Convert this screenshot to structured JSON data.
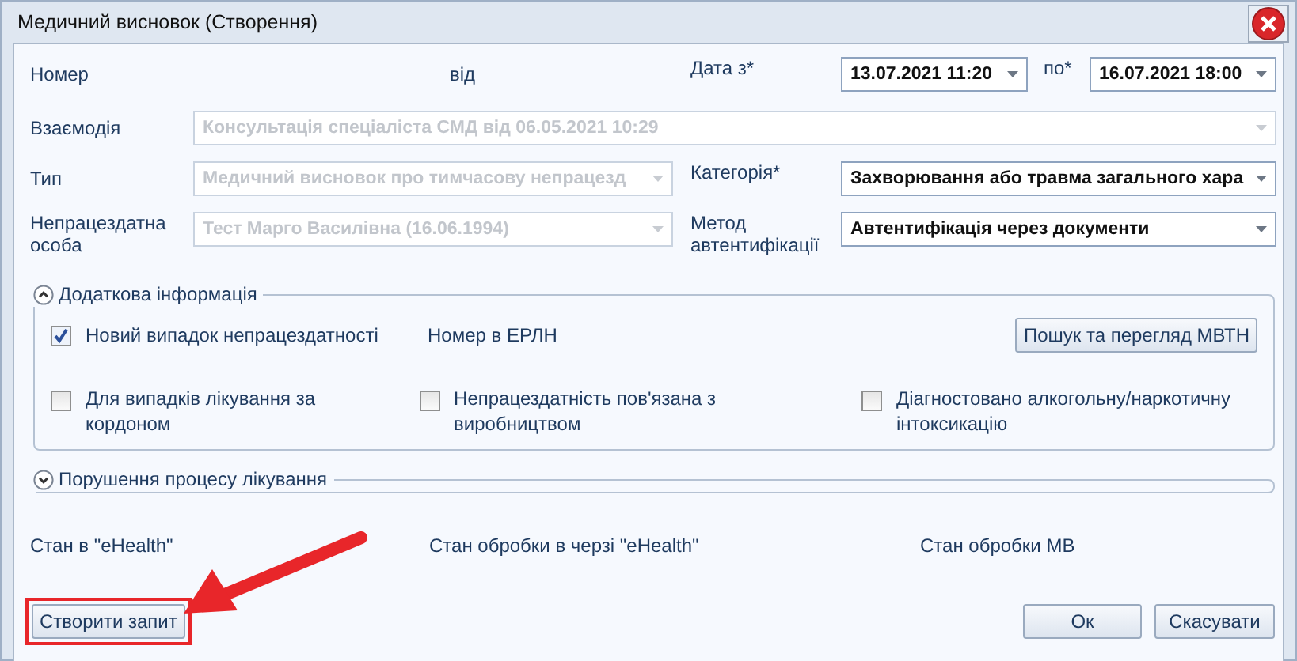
{
  "window": {
    "title": "Медичний висновок (Створення)"
  },
  "number": {
    "label": "Номер"
  },
  "from_label": "від",
  "date_from": {
    "label": "Дата з*",
    "value": "13.07.2021 11:20"
  },
  "date_to": {
    "label": "по*",
    "value": "16.07.2021 18:00"
  },
  "interaction": {
    "label": "Взаємодія",
    "value": "Консультація спеціаліста СМД від 06.05.2021 10:29",
    "disabled": true
  },
  "type": {
    "label": "Тип",
    "value": "Медичний висновок про тимчасову непрацезд",
    "disabled": true
  },
  "category": {
    "label": "Категорія*",
    "value": "Захворювання або травма загального хара",
    "disabled": false
  },
  "person": {
    "label": "Непрацездатна особа",
    "value": "Тест Марго Василівна (16.06.1994)",
    "disabled": true
  },
  "auth_method": {
    "label": "Метод автентифікації",
    "value": "Автентифікація через документи",
    "disabled": false
  },
  "additional_info": {
    "title": "Додаткова інформація",
    "expanded": true,
    "new_case": {
      "label": "Новий випадок непрацездатності",
      "checked": true
    },
    "erln_label": "Номер в ЕРЛН",
    "search_button": "Пошук та перегляд МВТН",
    "checkboxes": [
      {
        "label": "Для випадків лікування за кордоном",
        "checked": false
      },
      {
        "label": "Непрацездатність пов'язана з виробництвом",
        "checked": false
      },
      {
        "label": "Діагностовано алкогольну/наркотичну інтоксикацію",
        "checked": false
      }
    ]
  },
  "treatment_violation": {
    "title": "Порушення процесу лікування",
    "expanded": false
  },
  "statuses": [
    "Стан в \"eHealth\"",
    "Стан обробки в черзі \"eHealth\"",
    "Стан обробки МВ"
  ],
  "create_button": {
    "label": "Створити запит",
    "highlighted": true
  },
  "ok_button": "Ок",
  "cancel_button": "Скасувати"
}
